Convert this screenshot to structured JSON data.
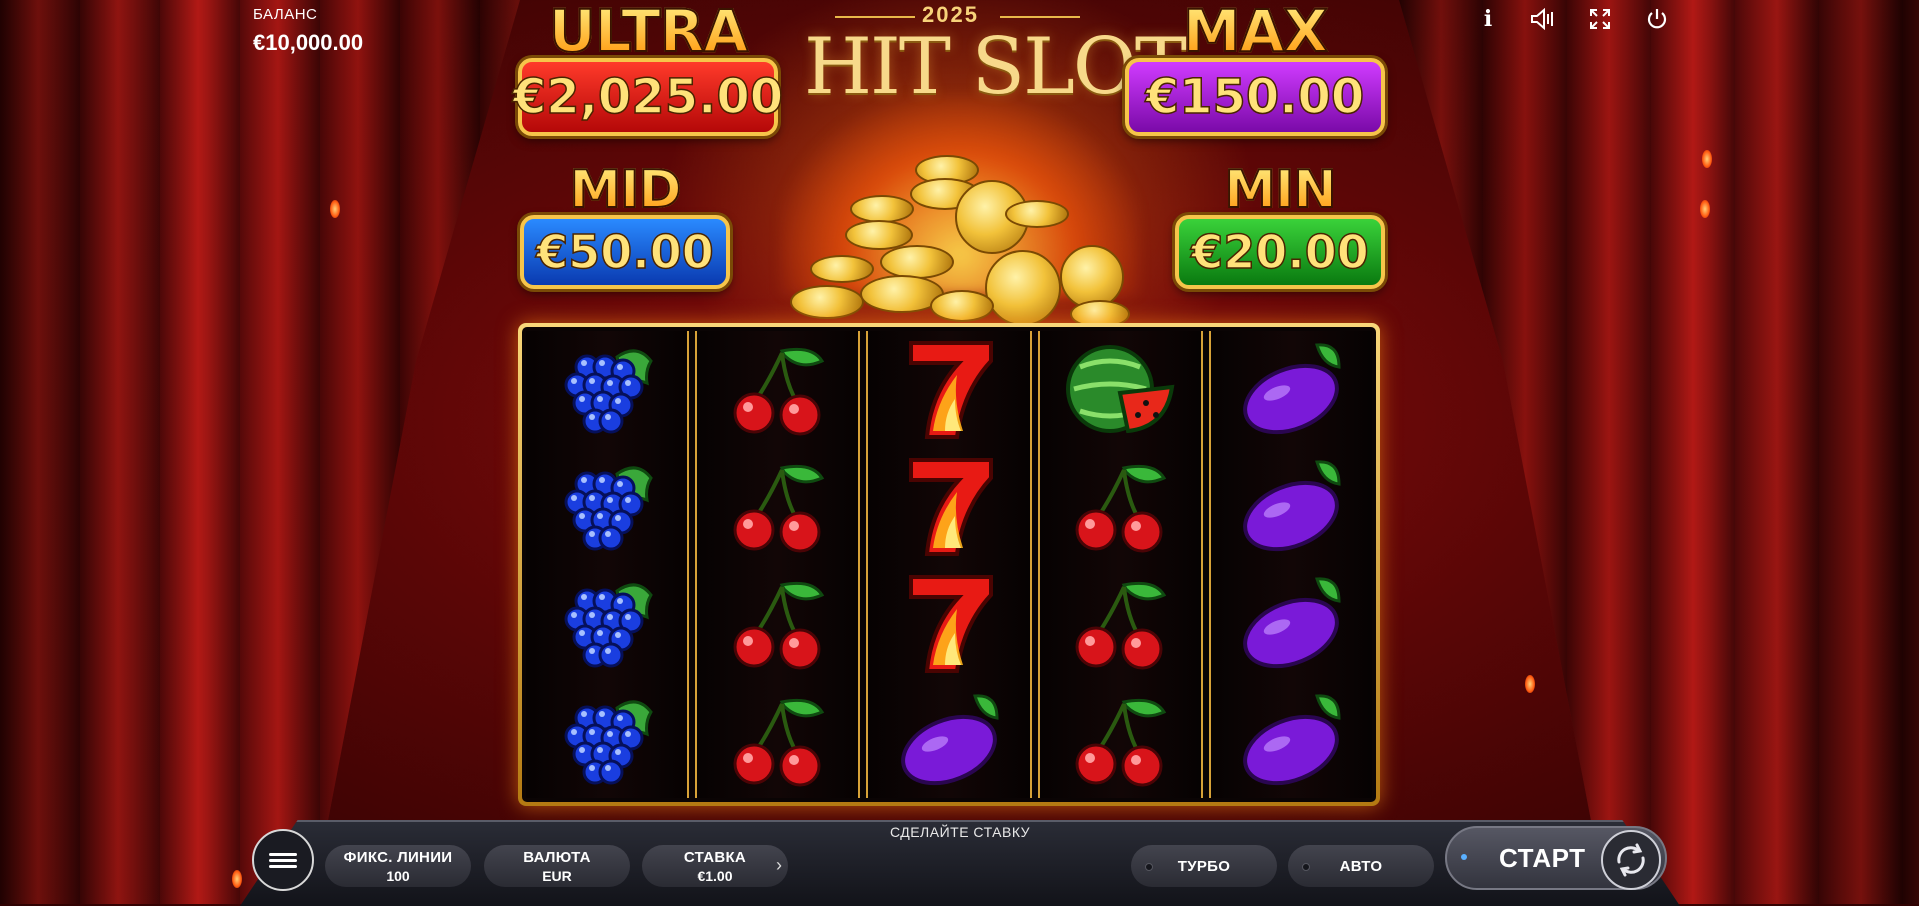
{
  "balance": {
    "label": "БАЛАНС",
    "value": "€10,000.00"
  },
  "logo": {
    "year": "2025",
    "title": "HIT SLOT"
  },
  "jackpots": {
    "ultra": {
      "name": "ULTRA",
      "amount": "€2,025.00",
      "color": "#d81a12"
    },
    "max": {
      "name": "MAX",
      "amount": "€150.00",
      "color": "#a11ad8"
    },
    "mid": {
      "name": "MID",
      "amount": "€50.00",
      "color": "#1a5ad8"
    },
    "min": {
      "name": "MIN",
      "amount": "€20.00",
      "color": "#1aa81a"
    }
  },
  "top_icons": [
    "info-icon",
    "sound-icon",
    "fullscreen-icon",
    "power-icon"
  ],
  "reels": [
    [
      "grapes",
      "grapes",
      "grapes",
      "grapes"
    ],
    [
      "cherries",
      "cherries",
      "cherries",
      "cherries"
    ],
    [
      "seven",
      "seven",
      "seven",
      "plum"
    ],
    [
      "watermelon",
      "cherries",
      "cherries",
      "cherries"
    ],
    [
      "plum",
      "plum",
      "plum",
      "plum"
    ]
  ],
  "controls": {
    "prompt": "СДЕЛАЙТЕ СТАВКУ",
    "lines": {
      "label": "ФИКС. ЛИНИИ",
      "value": "100"
    },
    "currency": {
      "label": "ВАЛЮТА",
      "value": "EUR"
    },
    "bet": {
      "label": "СТАВКА",
      "value": "€1.00"
    },
    "turbo": "ТУРБО",
    "auto": "АВТО",
    "start": "СТАРТ"
  }
}
